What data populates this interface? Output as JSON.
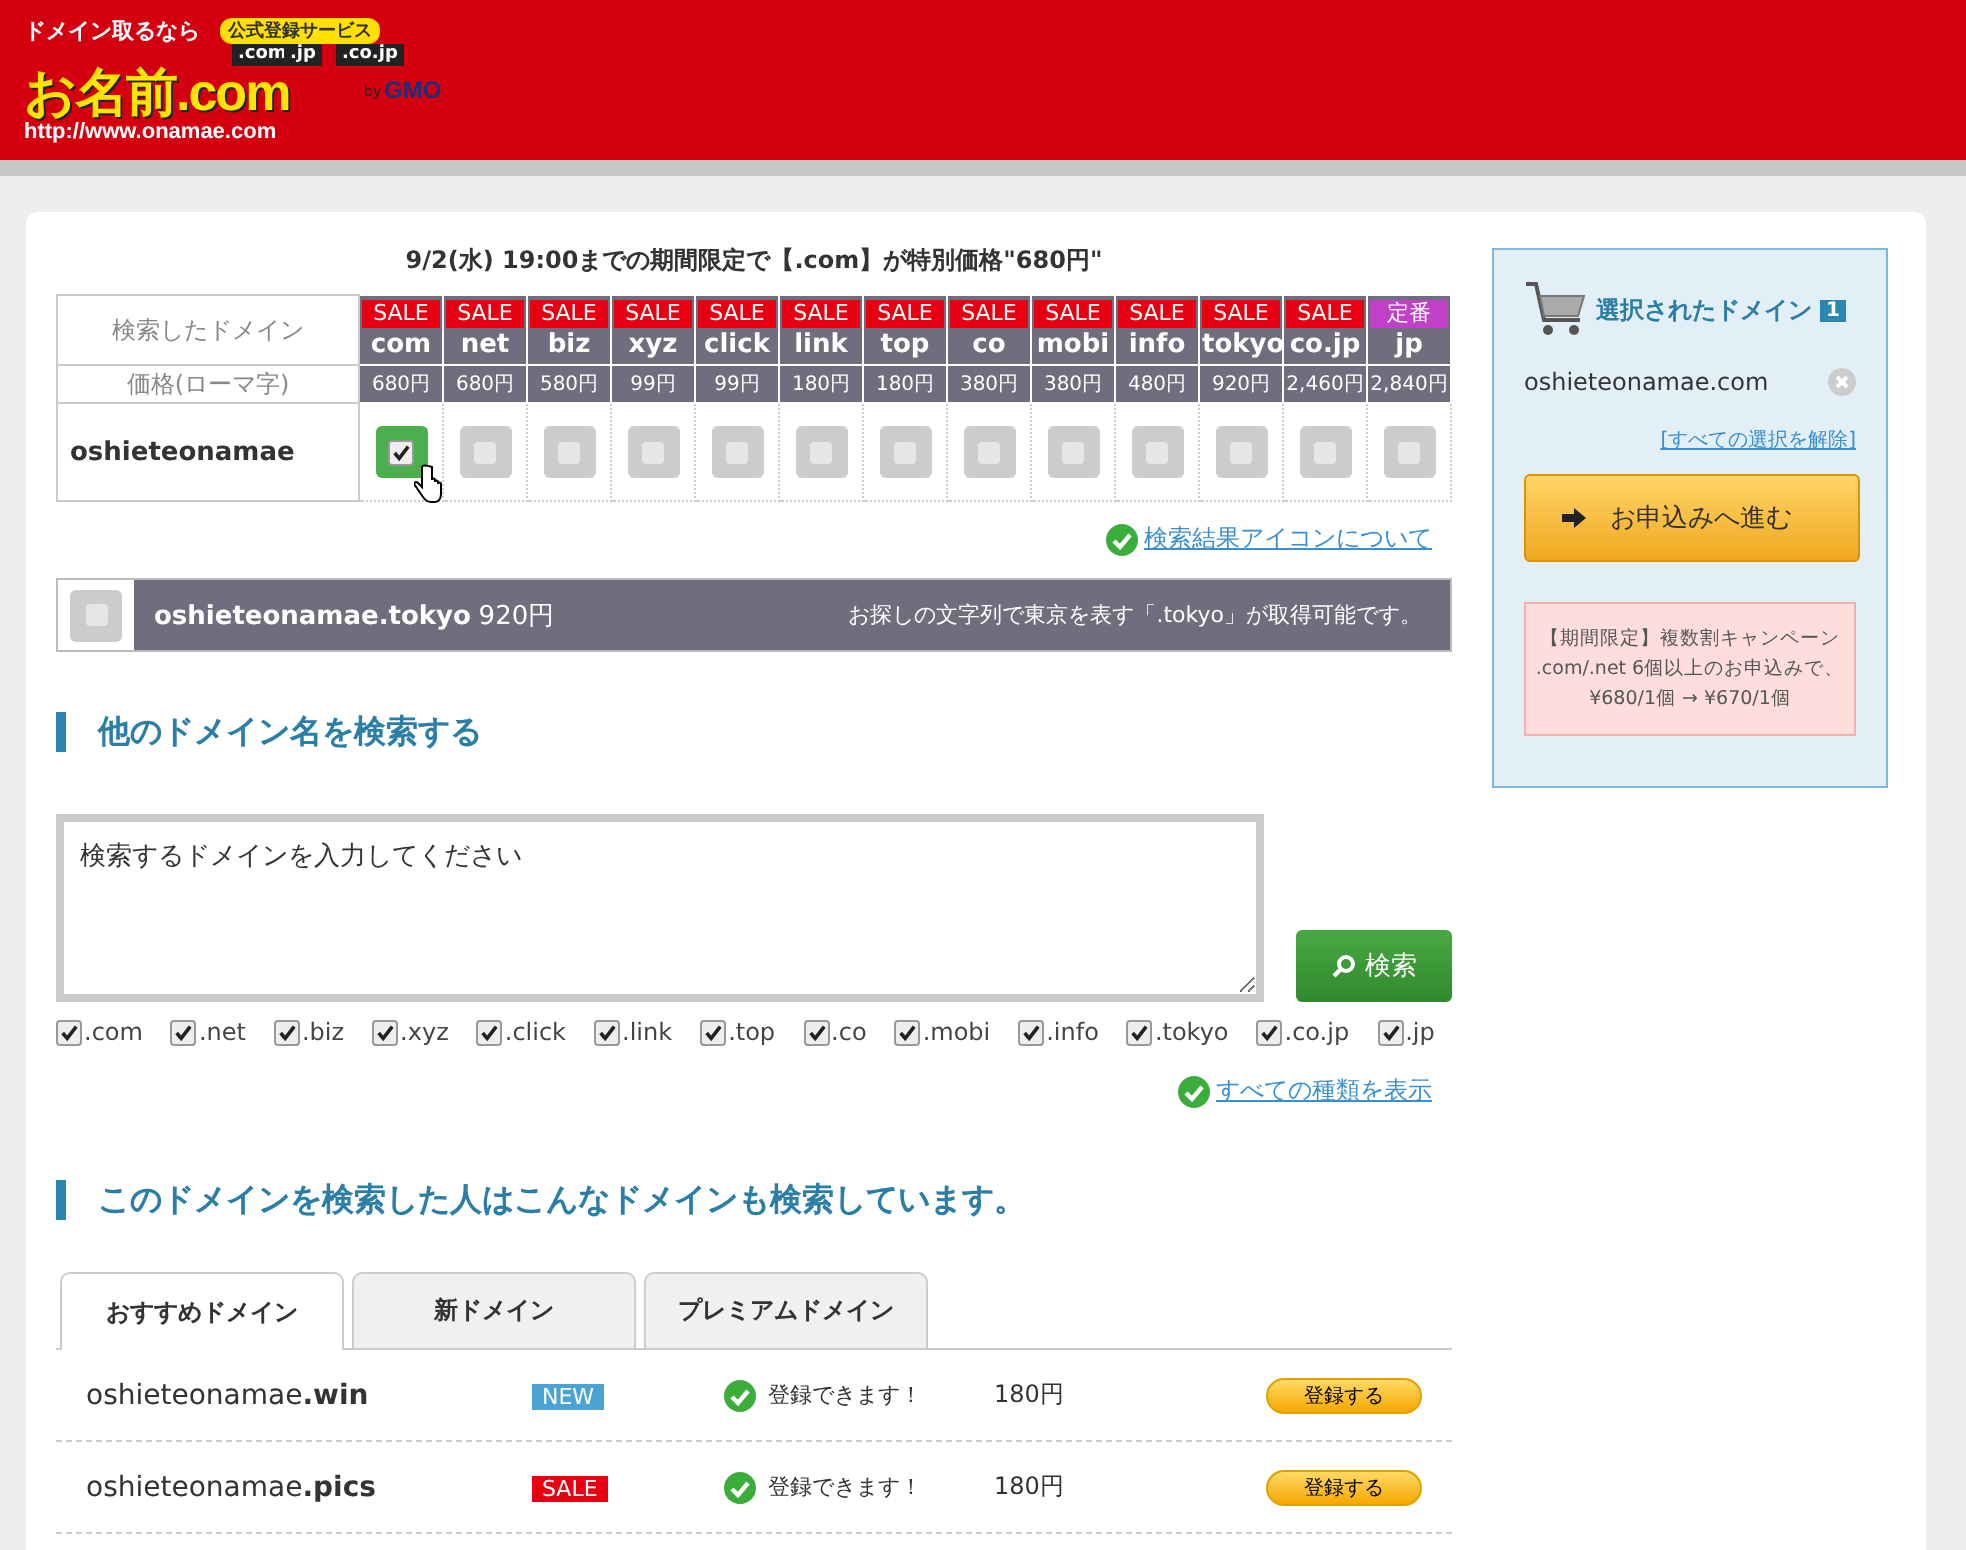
{
  "logo": {
    "tagline": "ドメイン取るなら",
    "badge": "公式登録サービス",
    "tlds": [
      ".com",
      ".jp",
      ".co.jp"
    ],
    "name": "お名前.com",
    "by": "by",
    "maker": "GMO",
    "url": "http://www.onamae.com"
  },
  "notice": "9/2(水) 19:00までの期間限定で【.com】が特別価格\"680円\"",
  "result_table": {
    "header_label": "検索したドメイン",
    "price_label": "価格(ローマ字)",
    "query": "oshieteonamae",
    "columns": [
      {
        "badge": "SALE",
        "kind": "sale",
        "tld": "com",
        "price": "680円",
        "checked": true
      },
      {
        "badge": "SALE",
        "kind": "sale",
        "tld": "net",
        "price": "680円",
        "checked": false
      },
      {
        "badge": "SALE",
        "kind": "sale",
        "tld": "biz",
        "price": "580円",
        "checked": false
      },
      {
        "badge": "SALE",
        "kind": "sale",
        "tld": "xyz",
        "price": "99円",
        "checked": false
      },
      {
        "badge": "SALE",
        "kind": "sale",
        "tld": "click",
        "price": "99円",
        "checked": false
      },
      {
        "badge": "SALE",
        "kind": "sale",
        "tld": "link",
        "price": "180円",
        "checked": false
      },
      {
        "badge": "SALE",
        "kind": "sale",
        "tld": "top",
        "price": "180円",
        "checked": false
      },
      {
        "badge": "SALE",
        "kind": "sale",
        "tld": "co",
        "price": "380円",
        "checked": false
      },
      {
        "badge": "SALE",
        "kind": "sale",
        "tld": "mobi",
        "price": "380円",
        "checked": false
      },
      {
        "badge": "SALE",
        "kind": "sale",
        "tld": "info",
        "price": "480円",
        "checked": false
      },
      {
        "badge": "SALE",
        "kind": "sale",
        "tld": "tokyo",
        "price": "920円",
        "checked": false
      },
      {
        "badge": "SALE",
        "kind": "sale",
        "tld": "co.jp",
        "price": "2,460円",
        "checked": false
      },
      {
        "badge": "定番",
        "kind": "standard",
        "tld": "jp",
        "price": "2,840円",
        "checked": false
      }
    ]
  },
  "icon_help_link": "検索結果アイコンについて",
  "suggestion": {
    "checked": false,
    "domain": "oshieteonamae.tokyo",
    "price": "920円",
    "note": "お探しの文字列で東京を表す「.tokyo」が取得可能です。"
  },
  "search_section": {
    "heading": "他のドメイン名を検索する",
    "placeholder": "検索するドメインを入力してください",
    "button": "検索",
    "tlds": [
      {
        "label": ".com",
        "checked": true
      },
      {
        "label": ".net",
        "checked": true
      },
      {
        "label": ".biz",
        "checked": true
      },
      {
        "label": ".xyz",
        "checked": true
      },
      {
        "label": ".click",
        "checked": true
      },
      {
        "label": ".link",
        "checked": true
      },
      {
        "label": ".top",
        "checked": true
      },
      {
        "label": ".co",
        "checked": true
      },
      {
        "label": ".mobi",
        "checked": true
      },
      {
        "label": ".info",
        "checked": true
      },
      {
        "label": ".tokyo",
        "checked": true
      },
      {
        "label": ".co.jp",
        "checked": true
      },
      {
        "label": ".jp",
        "checked": true
      }
    ],
    "show_all_link": "すべての種類を表示"
  },
  "related": {
    "heading": "このドメインを検索した人はこんなドメインも検索しています。",
    "tabs": [
      {
        "label": "おすすめドメイン",
        "selected": true
      },
      {
        "label": "新ドメイン",
        "selected": false
      },
      {
        "label": "プレミアムドメイン",
        "selected": false
      }
    ],
    "rows": [
      {
        "name": "oshieteonamae",
        "tld": ".win",
        "badge": "NEW",
        "kind": "new",
        "status": "登録できます！",
        "price": "180円",
        "button": "登録する"
      },
      {
        "name": "oshieteonamae",
        "tld": ".pics",
        "badge": "SALE",
        "kind": "sale",
        "status": "登録できます！",
        "price": "180円",
        "button": "登録する"
      }
    ]
  },
  "cart": {
    "title": "選択されたドメイン",
    "count": "1",
    "items": [
      "oshieteonamae.com"
    ],
    "clear_link": "[すべての選択を解除]",
    "proceed_button": "お申込みへ進む",
    "campaign": [
      "【期間限定】複数割キャンペーン",
      ".com/.net 6個以上のお申込みで、",
      "¥680/1個 → ¥670/1個"
    ]
  }
}
